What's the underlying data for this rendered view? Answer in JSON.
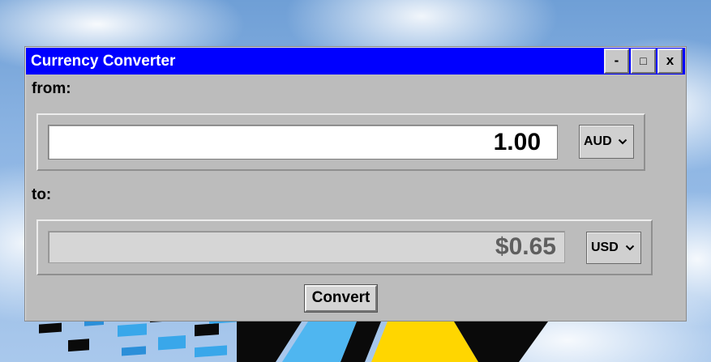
{
  "window": {
    "title": "Currency Converter",
    "minimize_label": "-",
    "maximize_label": "□",
    "close_label": "x",
    "titlebar_color": "#0000ff",
    "body_color": "#bcbcbc"
  },
  "from": {
    "label": "from:",
    "amount": "1.00",
    "currency": "AUD"
  },
  "to": {
    "label": "to:",
    "amount": "$0.65",
    "currency": "USD"
  },
  "convert_label": "Convert",
  "icons": {
    "dropdown": "chevron-down-icon"
  }
}
